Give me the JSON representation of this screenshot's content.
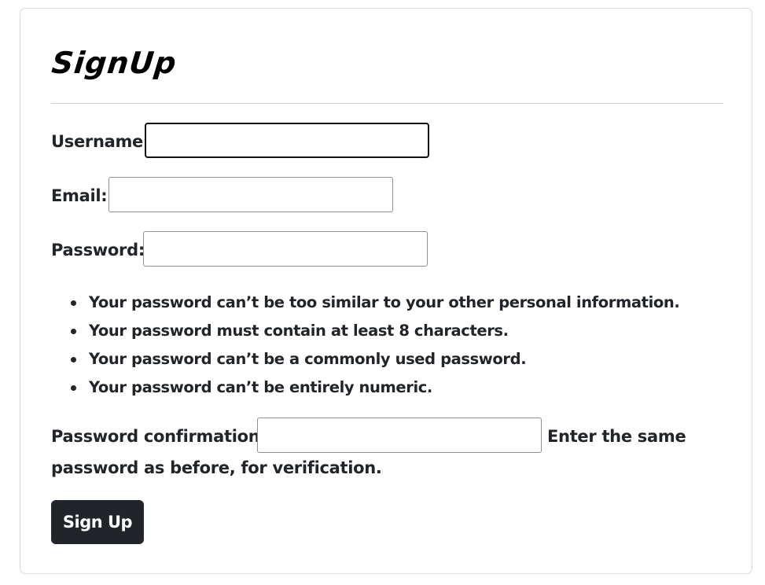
{
  "form": {
    "title": "SignUp",
    "fields": {
      "username": {
        "label": "Username:",
        "value": "",
        "focused": true
      },
      "email": {
        "label": "Email:",
        "value": ""
      },
      "password": {
        "label": "Password:",
        "value": ""
      },
      "password_confirmation": {
        "label": "Password confirmation:",
        "value": "",
        "help_line1": "Enter the same",
        "help_line2": "password as before, for verification."
      }
    },
    "password_rules": [
      "Your password can’t be too similar to your other personal information.",
      "Your password must contain at least 8 characters.",
      "Your password can’t be a commonly used password.",
      "Your password can’t be entirely numeric."
    ],
    "submit_label": "Sign Up"
  }
}
